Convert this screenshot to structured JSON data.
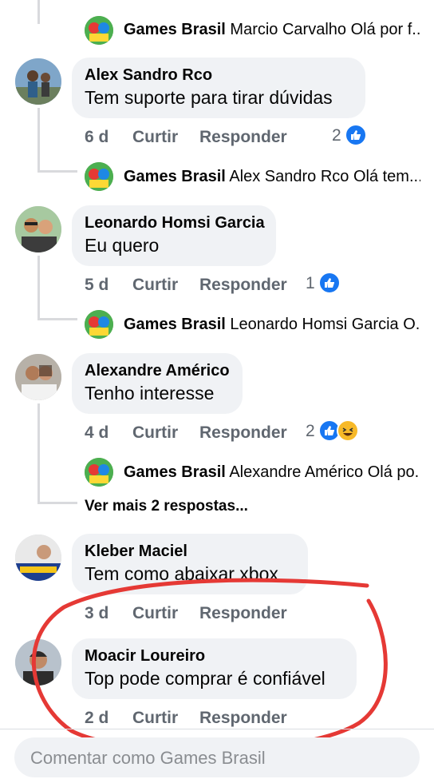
{
  "top_reply": {
    "author": "Games Brasil",
    "text": "Marcio Carvalho Olá por f..."
  },
  "comments": [
    {
      "author": "Alex Sandro Rco",
      "text": "Tem suporte para tirar dúvidas",
      "time": "6 d",
      "like_label": "Curtir",
      "reply_label": "Responder",
      "reaction_count": "2",
      "reactions": [
        "like"
      ],
      "reply": {
        "author": "Games Brasil",
        "text": "Alex Sandro Rco Olá tem..."
      }
    },
    {
      "author": "Leonardo Homsi Garcia",
      "text": "Eu quero",
      "time": "5 d",
      "like_label": "Curtir",
      "reply_label": "Responder",
      "reaction_count": "1",
      "reactions": [
        "like"
      ],
      "reply": {
        "author": "Games Brasil",
        "text": "Leonardo Homsi Garcia O..."
      }
    },
    {
      "author": "Alexandre Américo",
      "text": "Tenho interesse",
      "time": "4 d",
      "like_label": "Curtir",
      "reply_label": "Responder",
      "reaction_count": "2",
      "reactions": [
        "like",
        "haha"
      ],
      "reply": {
        "author": "Games Brasil",
        "text": "Alexandre Américo Olá po..."
      },
      "see_more": "Ver mais 2 respostas..."
    },
    {
      "author": "Kleber Maciel",
      "text": "Tem como abaixar xbox",
      "time": "3 d",
      "like_label": "Curtir",
      "reply_label": "Responder"
    },
    {
      "author": "Moacir Loureiro",
      "text": "Top pode comprar é confiável",
      "time": "2 d",
      "like_label": "Curtir",
      "reply_label": "Responder"
    }
  ],
  "composer": {
    "placeholder": "Comentar como Games Brasil"
  },
  "colors": {
    "bubble": "#f0f2f5",
    "meta_text": "#606770",
    "like_blue": "#1877f2",
    "annotation_red": "#e53935"
  }
}
